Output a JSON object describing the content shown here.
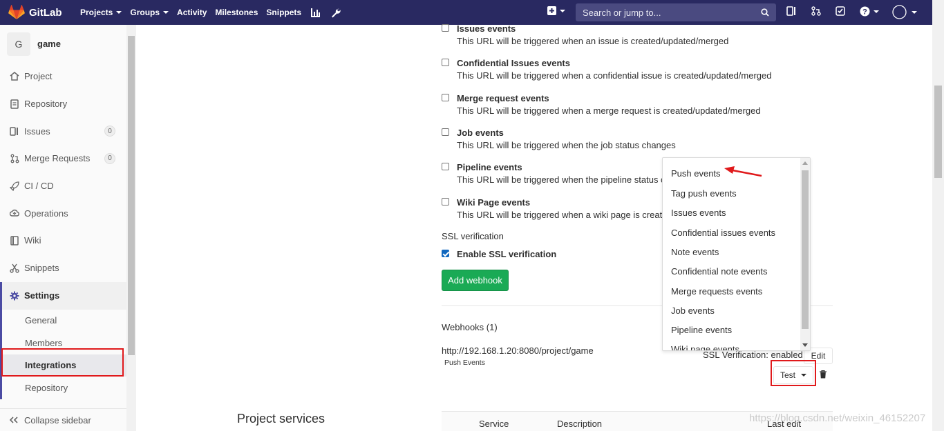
{
  "topbar": {
    "brand": "GitLab",
    "nav": [
      "Projects",
      "Groups",
      "Activity",
      "Milestones",
      "Snippets"
    ],
    "search_placeholder": "Search or jump to..."
  },
  "sidebar": {
    "project_initial": "G",
    "project_name": "game",
    "items": [
      {
        "label": "Project",
        "icon": "home-icon"
      },
      {
        "label": "Repository",
        "icon": "doc-icon"
      },
      {
        "label": "Issues",
        "icon": "issues-icon",
        "count": "0"
      },
      {
        "label": "Merge Requests",
        "icon": "merge-icon",
        "count": "0"
      },
      {
        "label": "CI / CD",
        "icon": "rocket-icon"
      },
      {
        "label": "Operations",
        "icon": "cloud-icon"
      },
      {
        "label": "Wiki",
        "icon": "book-icon"
      },
      {
        "label": "Snippets",
        "icon": "scissors-icon"
      }
    ],
    "settings": {
      "label": "Settings",
      "sub": [
        "General",
        "Members",
        "Integrations",
        "Repository"
      ]
    },
    "collapse": "Collapse sidebar"
  },
  "triggers": [
    {
      "title": "Issues events",
      "desc": "This URL will be triggered when an issue is created/updated/merged"
    },
    {
      "title": "Confidential Issues events",
      "desc": "This URL will be triggered when a confidential issue is created/updated/merged"
    },
    {
      "title": "Merge request events",
      "desc": "This URL will be triggered when a merge request is created/updated/merged"
    },
    {
      "title": "Job events",
      "desc": "This URL will be triggered when the job status changes"
    },
    {
      "title": "Pipeline events",
      "desc": "This URL will be triggered when the pipeline status ch"
    },
    {
      "title": "Wiki Page events",
      "desc": "This URL will be triggered when a wiki page is created"
    }
  ],
  "ssl": {
    "heading": "SSL verification",
    "label": "Enable SSL verification",
    "checked": true
  },
  "add_webhook": "Add webhook",
  "webhooks": {
    "heading": "Webhooks (1)",
    "url": "http://192.168.1.20:8080/project/game",
    "label": "Push Events",
    "ssl_status": "SSL Verification: enabled",
    "edit": "Edit",
    "test": "Test"
  },
  "dropdown": [
    "Push events",
    "Tag push events",
    "Issues events",
    "Confidential issues events",
    "Note events",
    "Confidential note events",
    "Merge requests events",
    "Job events",
    "Pipeline events",
    "Wiki page events"
  ],
  "services": {
    "heading": "Project services",
    "columns": [
      "Service",
      "Description",
      "Last edit"
    ]
  },
  "watermark": "https://blog.csdn.net/weixin_46152207",
  "colors": {
    "topbar": "#292961",
    "accent": "#4b4ba3",
    "green": "#1aaa55",
    "highlight": "#e0191b"
  }
}
